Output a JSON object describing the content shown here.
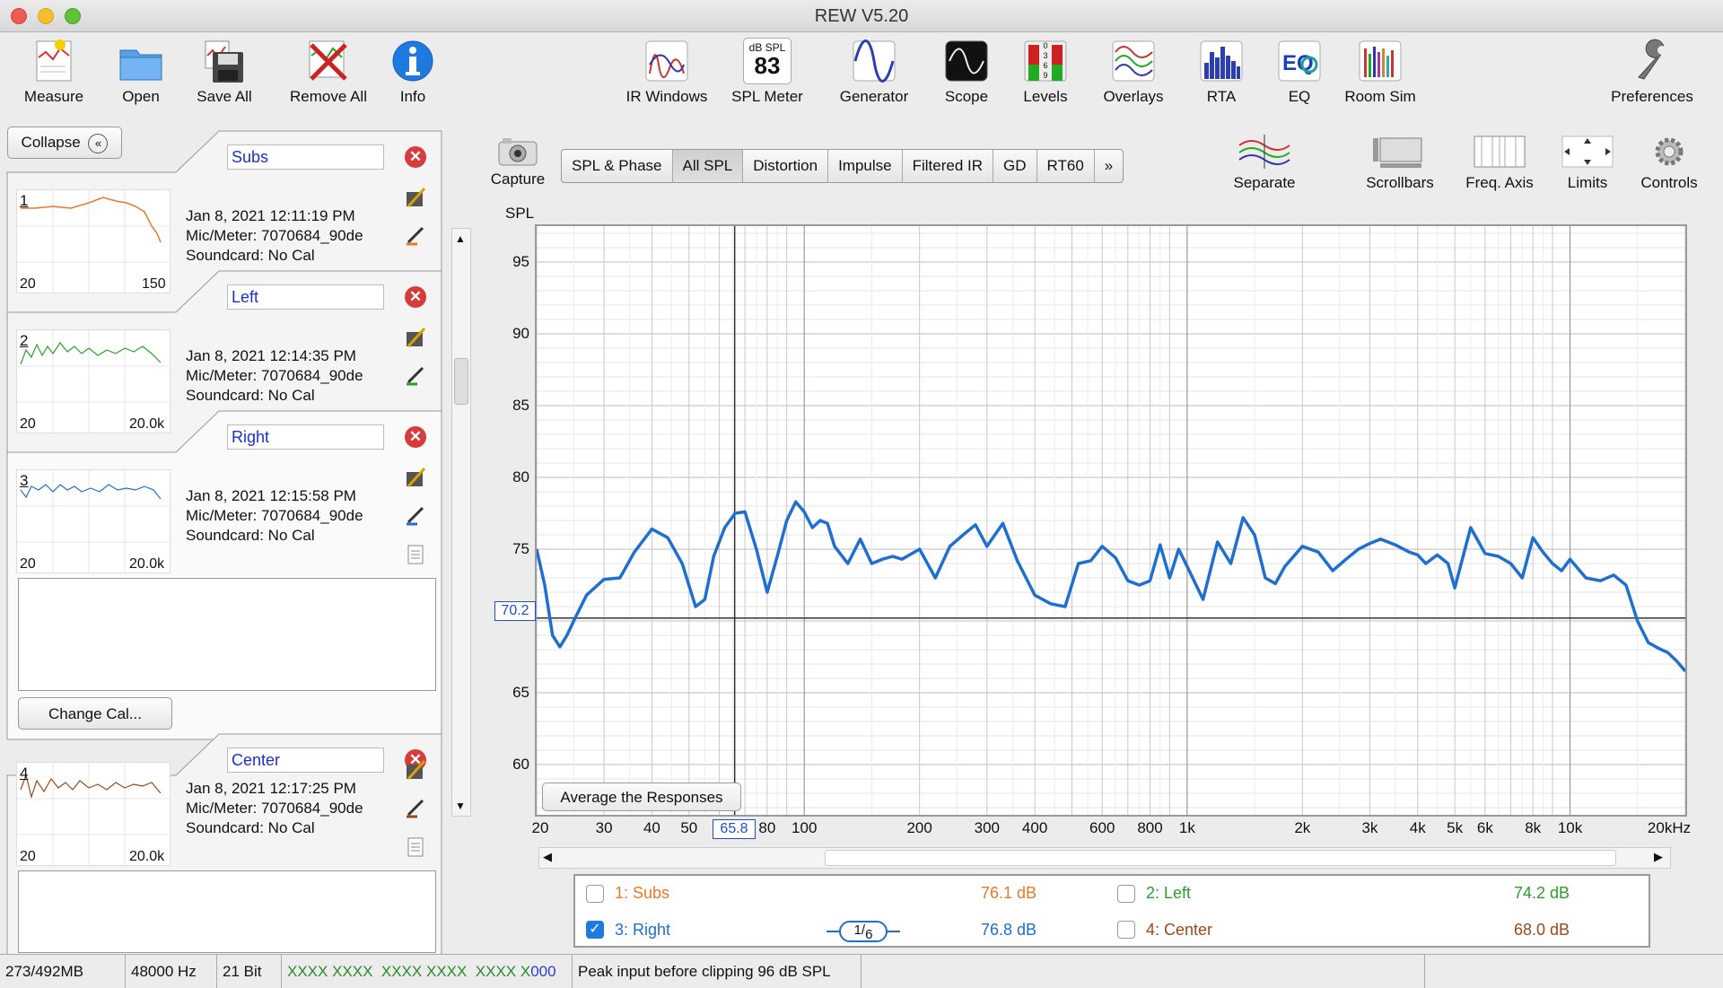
{
  "window": {
    "title": "REW V5.20"
  },
  "toolbar_left": [
    {
      "label": "Measure",
      "icon": "measure-icon"
    },
    {
      "label": "Open",
      "icon": "folder-icon"
    },
    {
      "label": "Save All",
      "icon": "save-icon"
    },
    {
      "label": "Remove All",
      "icon": "remove-all-icon"
    },
    {
      "label": "Info",
      "icon": "info-icon"
    }
  ],
  "toolbar_main": [
    {
      "label": "IR Windows",
      "icon": "ir-windows-icon"
    },
    {
      "label": "SPL Meter",
      "icon": "spl-meter-icon",
      "readout_top": "dB SPL",
      "readout_value": "83"
    },
    {
      "label": "Generator",
      "icon": "generator-icon"
    },
    {
      "label": "Scope",
      "icon": "scope-icon"
    },
    {
      "label": "Levels",
      "icon": "levels-icon",
      "digits": "0 3 6 9"
    },
    {
      "label": "Overlays",
      "icon": "overlays-icon"
    },
    {
      "label": "RTA",
      "icon": "rta-icon"
    },
    {
      "label": "EQ",
      "icon": "eq-icon"
    },
    {
      "label": "Room Sim",
      "icon": "room-sim-icon"
    }
  ],
  "toolbar_right": {
    "label": "Preferences",
    "icon": "wrench-icon"
  },
  "sidebar": {
    "collapse_label": "Collapse",
    "change_cal_label": "Change Cal...",
    "measurements": [
      {
        "index": "1",
        "name": "Subs",
        "date": "Jan 8, 2021 12:11:19 PM",
        "mic": "Mic/Meter: 7070684_90de",
        "soundcard": "Soundcard: No Cal",
        "thumb_min": "20",
        "thumb_max": "150",
        "color": "#e8792a"
      },
      {
        "index": "2",
        "name": "Left",
        "date": "Jan 8, 2021 12:14:35 PM",
        "mic": "Mic/Meter: 7070684_90de",
        "soundcard": "Soundcard: No Cal",
        "thumb_min": "20",
        "thumb_max": "20.0k",
        "color": "#2aa02a"
      },
      {
        "index": "3",
        "name": "Right",
        "date": "Jan 8, 2021 12:15:58 PM",
        "mic": "Mic/Meter: 7070684_90de",
        "soundcard": "Soundcard: No Cal",
        "thumb_min": "20",
        "thumb_max": "20.0k",
        "color": "#1f6fd0"
      },
      {
        "index": "4",
        "name": "Center",
        "date": "Jan 8, 2021 12:17:25 PM",
        "mic": "Mic/Meter: 7070684_90de",
        "soundcard": "Soundcard: No Cal",
        "thumb_min": "20",
        "thumb_max": "20.0k",
        "color": "#9a4a1a"
      }
    ]
  },
  "graph_toolbar": {
    "capture_label": "Capture",
    "tabs": [
      "SPL & Phase",
      "All SPL",
      "Distortion",
      "Impulse",
      "Filtered IR",
      "GD",
      "RT60",
      "»"
    ],
    "active_tab": "All SPL",
    "right_buttons": [
      {
        "label": "Separate",
        "icon": "separate-icon"
      },
      {
        "label": "Scrollbars",
        "icon": "scrollbars-icon"
      },
      {
        "label": "Freq. Axis",
        "icon": "freq-axis-icon"
      },
      {
        "label": "Limits",
        "icon": "limits-icon"
      },
      {
        "label": "Controls",
        "icon": "gear-icon"
      }
    ]
  },
  "graph": {
    "y_axis_title": "SPL",
    "average_button": "Average the Responses",
    "cursor_y": "70.2",
    "cursor_x": "65.8",
    "y_ticks": [
      "95",
      "90",
      "85",
      "80",
      "75",
      "70",
      "65",
      "60"
    ],
    "x_ticks": [
      "20",
      "30",
      "40",
      "50",
      "80",
      "100",
      "200",
      "300",
      "400",
      "600",
      "800",
      "1k",
      "2k",
      "3k",
      "4k",
      "5k",
      "6k",
      "8k",
      "10k",
      "20kHz"
    ]
  },
  "chart_data": {
    "type": "line",
    "x_scale": "log",
    "xlim": [
      20,
      20000
    ],
    "ylim": [
      56.5,
      97.5
    ],
    "ylabel": "SPL",
    "grid": true,
    "cursor": {
      "x": 65.8,
      "y": 70.2
    },
    "series": [
      {
        "name": "3: Right",
        "color": "#1f6fd0",
        "x": [
          20,
          21,
          22,
          23,
          24,
          25,
          27,
          30,
          33,
          36,
          40,
          44,
          48,
          52,
          55,
          58,
          62,
          66,
          70,
          75,
          80,
          85,
          90,
          95,
          100,
          105,
          110,
          115,
          120,
          130,
          140,
          150,
          160,
          170,
          180,
          200,
          220,
          240,
          260,
          280,
          300,
          330,
          360,
          400,
          440,
          480,
          520,
          560,
          600,
          650,
          700,
          750,
          800,
          850,
          900,
          950,
          1000,
          1100,
          1200,
          1300,
          1400,
          1500,
          1600,
          1700,
          1800,
          2000,
          2200,
          2400,
          2600,
          2800,
          3000,
          3200,
          3500,
          3800,
          4000,
          4200,
          4500,
          4800,
          5000,
          5500,
          6000,
          6500,
          7000,
          7500,
          8000,
          8500,
          9000,
          9500,
          10000,
          11000,
          12000,
          13000,
          14000,
          15000,
          16000,
          17000,
          18000,
          19000,
          20000
        ],
        "y": [
          75.0,
          72.5,
          69.0,
          68.2,
          69.0,
          70.0,
          71.8,
          72.9,
          73.0,
          74.8,
          76.4,
          75.8,
          74.0,
          71.0,
          71.5,
          74.5,
          76.5,
          77.5,
          77.6,
          75.0,
          72.0,
          74.5,
          77.0,
          78.3,
          77.6,
          76.5,
          77.0,
          76.8,
          75.2,
          74.0,
          75.7,
          74.0,
          74.3,
          74.5,
          74.3,
          75.0,
          73.0,
          75.2,
          76.0,
          76.7,
          75.2,
          76.8,
          74.2,
          71.8,
          71.2,
          71.0,
          74.0,
          74.2,
          75.2,
          74.4,
          72.8,
          72.5,
          72.8,
          75.3,
          73.0,
          75.0,
          73.8,
          71.5,
          75.5,
          74.0,
          77.2,
          76.0,
          73.0,
          72.6,
          73.8,
          75.2,
          74.8,
          73.5,
          74.3,
          75.0,
          75.4,
          75.7,
          75.3,
          74.8,
          74.6,
          74.0,
          74.6,
          74.0,
          72.3,
          76.5,
          74.7,
          74.5,
          74.0,
          73.0,
          75.8,
          74.8,
          74.0,
          73.5,
          74.3,
          73.0,
          72.8,
          73.2,
          72.5,
          70.0,
          68.5,
          68.1,
          67.8,
          67.2,
          66.5
        ]
      }
    ]
  },
  "legend": {
    "items": [
      {
        "label": "1: Subs",
        "value": "76.1 dB",
        "checked": false,
        "color": "#e8792a"
      },
      {
        "label": "2: Left",
        "value": "74.2 dB",
        "checked": false,
        "color": "#2aa02a"
      },
      {
        "label": "3: Right",
        "value": "76.8 dB",
        "checked": true,
        "color": "#1f6fd0"
      },
      {
        "label": "4: Center",
        "value": "68.0 dB",
        "checked": false,
        "color": "#9a4a1a"
      }
    ],
    "smoothing_num": "1",
    "smoothing_den": "6"
  },
  "statusbar": {
    "memory": "273/492MB",
    "sample_rate": "48000 Hz",
    "bits": "21 Bit",
    "inputs_green": "XXXX XXXX  XXXX XXXX  XXXX X",
    "inputs_blue": "000",
    "peak_text": "Peak input before clipping 96 dB SPL"
  },
  "colors": {
    "accent_blue": "#1f6fd0",
    "name_blue": "#1a2fd0",
    "delete_red": "#d63c3c"
  }
}
